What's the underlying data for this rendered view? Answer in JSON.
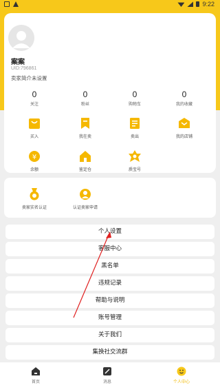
{
  "status_bar": {
    "time": "9:22"
  },
  "profile": {
    "username": "案案",
    "uid": "UID:796861",
    "bio": "卖家简介未设置"
  },
  "stats": [
    {
      "value": "0",
      "label": "关注"
    },
    {
      "value": "0",
      "label": "粉丝"
    },
    {
      "value": "0",
      "label": "购物车"
    },
    {
      "value": "0",
      "label": "我的收藏"
    }
  ],
  "grid_row1": [
    {
      "label": "买入",
      "icon": "bag-icon"
    },
    {
      "label": "我在卖",
      "icon": "bookmark-icon"
    },
    {
      "label": "卖出",
      "icon": "list-icon"
    },
    {
      "label": "我的店铺",
      "icon": "shop-icon"
    }
  ],
  "grid_row2": [
    {
      "label": "余额",
      "icon": "yen-icon"
    },
    {
      "label": "鉴定仓",
      "icon": "house-icon"
    },
    {
      "label": "质宝号",
      "icon": "star-badge-icon"
    }
  ],
  "verify": [
    {
      "label": "卖家实名认证",
      "icon": "medal-icon"
    },
    {
      "label": "认证卖家申请",
      "icon": "user-icon"
    }
  ],
  "menu": [
    "个人设置",
    "客服中心",
    "黑名单",
    "违规记录",
    "帮助与说明",
    "账号管理",
    "关于我们",
    "集换社交流群"
  ],
  "nav": [
    {
      "label": "首页",
      "icon": "home-icon"
    },
    {
      "label": "消息",
      "icon": "message-icon"
    },
    {
      "label": "个人中心",
      "icon": "smiley-icon",
      "active": true
    }
  ],
  "colors": {
    "brand": "#f7c81a",
    "accent": "#f0b800",
    "annotation_arrow": "#e02020"
  }
}
